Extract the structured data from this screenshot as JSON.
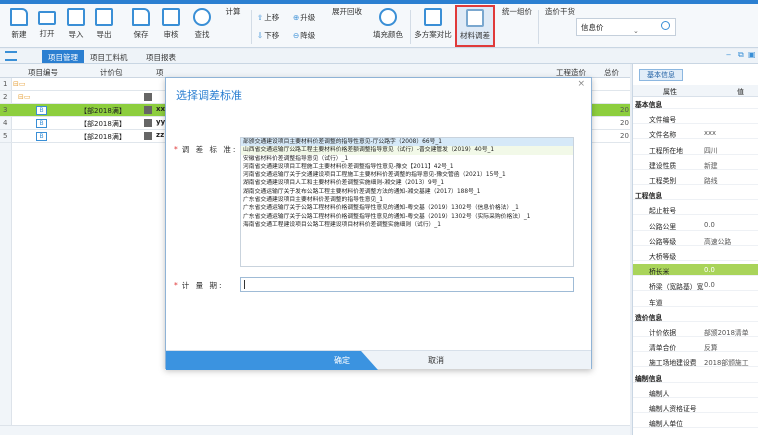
{
  "ribbon": {
    "buttons": [
      {
        "label": "新建",
        "icon": "new-file-icon"
      },
      {
        "label": "打开",
        "icon": "folder-open-icon"
      },
      {
        "label": "导入",
        "icon": "import-icon"
      },
      {
        "label": "导出",
        "icon": "export-icon"
      },
      {
        "label": "保存",
        "icon": "save-icon"
      },
      {
        "label": "审核",
        "icon": "audit-icon"
      },
      {
        "label": "查找",
        "icon": "search-icon"
      },
      {
        "label": "计算",
        "icon": "calculator-icon"
      }
    ],
    "move_up": "上移",
    "move_down": "下移",
    "level_up": "升级",
    "level_down": "降级",
    "expand_collapse": "展开回收",
    "fill_color": "填充颜色",
    "multi_compare": "多方案对比",
    "material_adjust": "材料调差",
    "unified_price": "统一组价",
    "pricing_dry": "造价干货",
    "info_price": "信息价"
  },
  "tabs": [
    "项目管理",
    "项目工料机",
    "项目报表"
  ],
  "grid": {
    "headers": [
      "项目编号",
      "计价包",
      "项"
    ],
    "rows": [
      {
        "num": "1",
        "name": "",
        "suffix": "",
        "total": ""
      },
      {
        "num": "2",
        "name": "",
        "suffix": "",
        "total": ""
      },
      {
        "num": "3",
        "name": "【部2018满】",
        "suffix": "xx",
        "total": "20"
      },
      {
        "num": "4",
        "name": "【部2018满】",
        "suffix": "yy",
        "total": "20"
      },
      {
        "num": "5",
        "name": "【部2018满】",
        "suffix": "zz",
        "total": "20"
      }
    ],
    "extra_header": "工程造价",
    "extra_header2": "总价"
  },
  "panel": {
    "tab": "基本信息",
    "header_prop": "属性",
    "header_val": "值",
    "rows": [
      {
        "k": "基本信息",
        "v": "",
        "group": true
      },
      {
        "k": "文件编号",
        "v": ""
      },
      {
        "k": "文件名称",
        "v": "xxx"
      },
      {
        "k": "工程所在地",
        "v": "四川"
      },
      {
        "k": "建设性质",
        "v": "新建"
      },
      {
        "k": "工程类别",
        "v": "路线"
      },
      {
        "k": "工程信息",
        "v": "",
        "group": true
      },
      {
        "k": "起止桩号",
        "v": ""
      },
      {
        "k": "公路公里",
        "v": "0.0"
      },
      {
        "k": "公路等级",
        "v": "高速公路"
      },
      {
        "k": "大桥等级",
        "v": ""
      },
      {
        "k": "桥长米",
        "v": "0.0",
        "hl": true
      },
      {
        "k": "桥梁（宽路基）宽",
        "v": "0.0"
      },
      {
        "k": "车道",
        "v": ""
      },
      {
        "k": "造价信息",
        "v": "",
        "group": true
      },
      {
        "k": "计价依据",
        "v": "部颁2018清单"
      },
      {
        "k": "清单合价",
        "v": "反算"
      },
      {
        "k": "施工场地建设费",
        "v": "2018部颁施工"
      },
      {
        "k": "编制信息",
        "v": "",
        "group": true
      },
      {
        "k": "编制人",
        "v": ""
      },
      {
        "k": "编制人资格证号",
        "v": ""
      },
      {
        "k": "编制人单位",
        "v": ""
      }
    ]
  },
  "dialog": {
    "title": "选择调差标准",
    "close": "×",
    "standard_label": "调 差 标 准:",
    "amount_label": "计  量  期:",
    "amount_value": "",
    "options": [
      "部颁交通建设项目主要材料价差调整的指导性意见-厅公路字（2008）66号_1",
      "山西省交通运输厅公路工程主要材料价格差额调整指导意见（试行）-晋交建管发（2019）40号_1",
      "安徽省材料价差调整指导意见（试行）_1",
      "河南省交通建设项目工程施工主要材料价差调整指导性意见-豫交【2011】42号_1",
      "河南省交通运输厅关于交通建设项目工程施工主要材料价差调整的指导意见-豫交管函（2021）15号_1",
      "湖南省交通建设项目人工和主要材料价差调整实施细则-湘交建（2013）9号_1",
      "湖南交通运输厅关于发布公路工程主要材料价差调整方法的通知-湘交基建（2017）188号_1",
      "广东省交通建设项目主要材料价差调整的指导性意见_1",
      "广东省交通运输厅关于公路工程材料价格调整指导性意见的通知-粤交基（2019）1302号（信息价格法）_1",
      "广东省交通运输厅关于公路工程材料价格调整指导性意见的通知-粤交基（2019）1302号（实际采购价格法）_1",
      "海南省交通工程建设项目公路工程建设项目材料价差调整实施细则（试行）_1"
    ],
    "ok": "确定",
    "cancel": "取消"
  }
}
